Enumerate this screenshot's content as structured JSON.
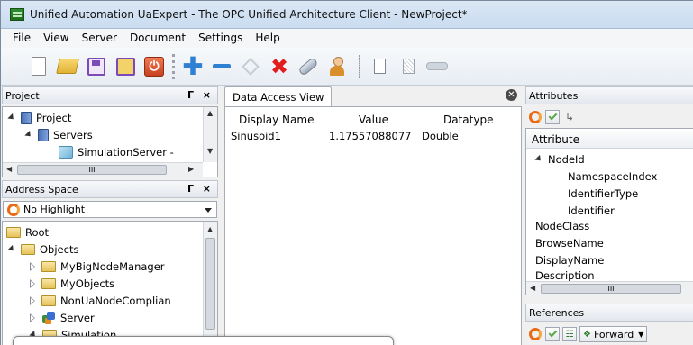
{
  "window": {
    "title": "Unified Automation UaExpert - The OPC Unified Architecture Client - NewProject*"
  },
  "menu": [
    "File",
    "View",
    "Server",
    "Document",
    "Settings",
    "Help"
  ],
  "toolbar": {
    "icons": [
      "new-document-icon",
      "open-folder-icon",
      "save-icon",
      "save-as-icon",
      "power-icon",
      "add-server-icon",
      "remove-server-icon",
      "connect-icon",
      "disconnect-icon",
      "settings-wrench-icon",
      "user-icon",
      "document-icon",
      "document-disabled-icon",
      "cable-icon"
    ]
  },
  "project_pane": {
    "header": "Project",
    "controls": "Г ×",
    "tree": [
      {
        "label": "Project",
        "level": 0,
        "expanded": true,
        "icon": "project-icon"
      },
      {
        "label": "Servers",
        "level": 1,
        "expanded": true,
        "icon": "project-icon"
      },
      {
        "label": "SimulationServer -",
        "level": 2,
        "icon": "simulation-server-icon"
      }
    ],
    "hscroll_glyph": "III"
  },
  "address_space": {
    "header": "Address Space",
    "controls": "Г ×",
    "highlight_value": "No Highlight",
    "tree": [
      {
        "label": "Root",
        "level": 0,
        "icon": "folder-icon",
        "arrow": "none"
      },
      {
        "label": "Objects",
        "level": 1,
        "icon": "folder-icon",
        "arrow": "open"
      },
      {
        "label": "MyBigNodeManager",
        "level": 2,
        "icon": "folder-icon",
        "arrow": "closed"
      },
      {
        "label": "MyObjects",
        "level": 2,
        "icon": "folder-icon",
        "arrow": "closed"
      },
      {
        "label": "NonUaNodeComplian",
        "level": 2,
        "icon": "folder-icon",
        "arrow": "closed"
      },
      {
        "label": "Server",
        "level": 2,
        "icon": "server-icon",
        "arrow": "closed"
      },
      {
        "label": "Simulation",
        "level": 2,
        "icon": "folder-icon",
        "arrow": "open"
      }
    ]
  },
  "data_access_view": {
    "tab": "Data Access View",
    "columns": [
      "Display Name",
      "Value",
      "Datatype"
    ],
    "rows": [
      {
        "display_name": "Sinusoid1",
        "value": "1.17557088077",
        "datatype": "Double"
      }
    ]
  },
  "attributes": {
    "header": "Attributes",
    "column": "Attribute",
    "rows": [
      {
        "label": "NodeId",
        "level": 0,
        "arrow": "open"
      },
      {
        "label": "NamespaceIndex",
        "level": 2
      },
      {
        "label": "IdentifierType",
        "level": 2
      },
      {
        "label": "Identifier",
        "level": 2
      },
      {
        "label": "NodeClass",
        "level": 0
      },
      {
        "label": "BrowseName",
        "level": 0
      },
      {
        "label": "DisplayName",
        "level": 0
      },
      {
        "label": "Description",
        "level": 0
      }
    ],
    "hscroll_glyph": "III"
  },
  "references": {
    "header": "References",
    "direction": "Forward"
  },
  "colors": {
    "accent": "#2f7fd2",
    "refresh": "#e86a14",
    "delete": "#e01e1e"
  }
}
